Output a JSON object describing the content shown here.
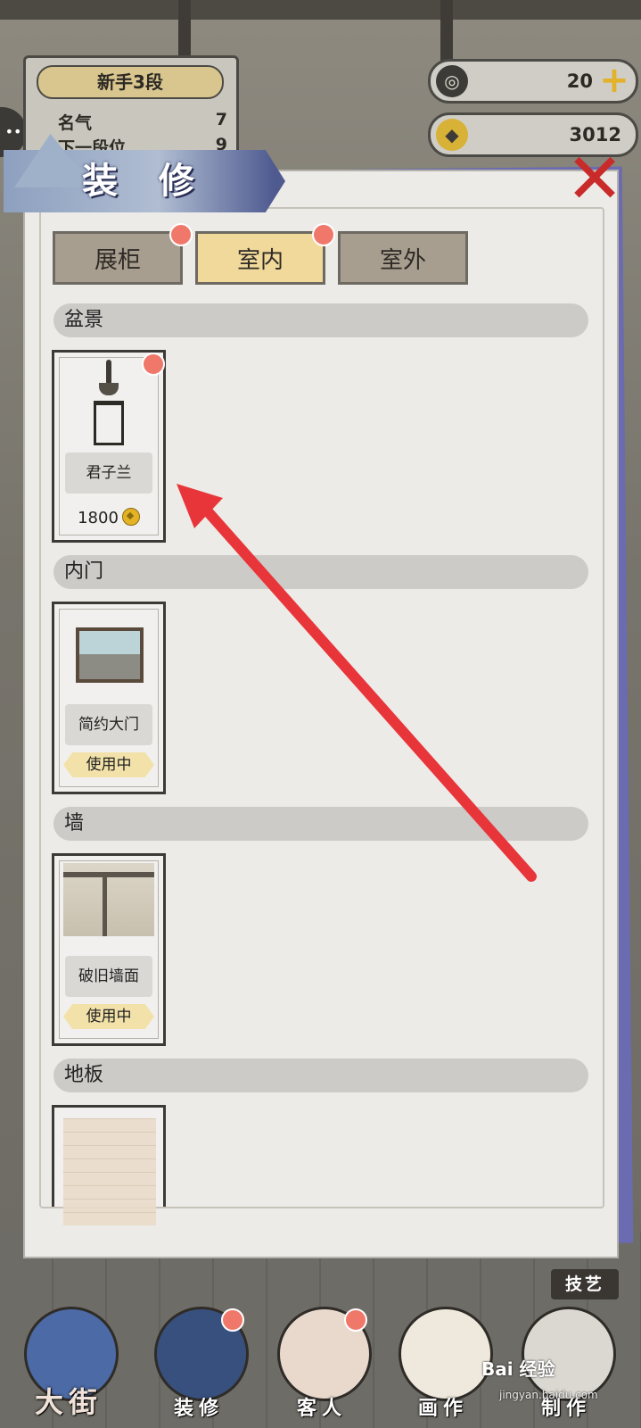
{
  "hud": {
    "rank_title": "新手3段",
    "stats": [
      {
        "label": "名气",
        "value": "7"
      },
      {
        "label": "下一段位",
        "value": "9"
      }
    ],
    "jade_value": "20",
    "coin_value": "3012"
  },
  "panel": {
    "title": "装 修",
    "tabs": [
      {
        "label": "展柜",
        "active": false,
        "dot": true
      },
      {
        "label": "室内",
        "active": true,
        "dot": true
      },
      {
        "label": "室外",
        "active": false,
        "dot": false
      }
    ],
    "sections": [
      {
        "label": "盆景",
        "items": [
          {
            "name": "君子兰",
            "price": "1800"
          }
        ]
      },
      {
        "label": "内门",
        "items": [
          {
            "name": "简约大门",
            "status": "使用中"
          }
        ]
      },
      {
        "label": "墙",
        "items": [
          {
            "name": "破旧墙面",
            "status": "使用中"
          }
        ]
      },
      {
        "label": "地板",
        "items": [
          {
            "name": ""
          }
        ]
      }
    ]
  },
  "nav": {
    "items": [
      "大街",
      "装修",
      "客人",
      "画作",
      "制作"
    ],
    "skill_label": "技艺"
  },
  "watermark": {
    "brand": "Bai 经验",
    "url": "jingyan.baidu.com"
  },
  "colors": {
    "accent_red": "#e8353a",
    "tab_active": "#f0d99b",
    "notification_dot": "#f0786a"
  }
}
